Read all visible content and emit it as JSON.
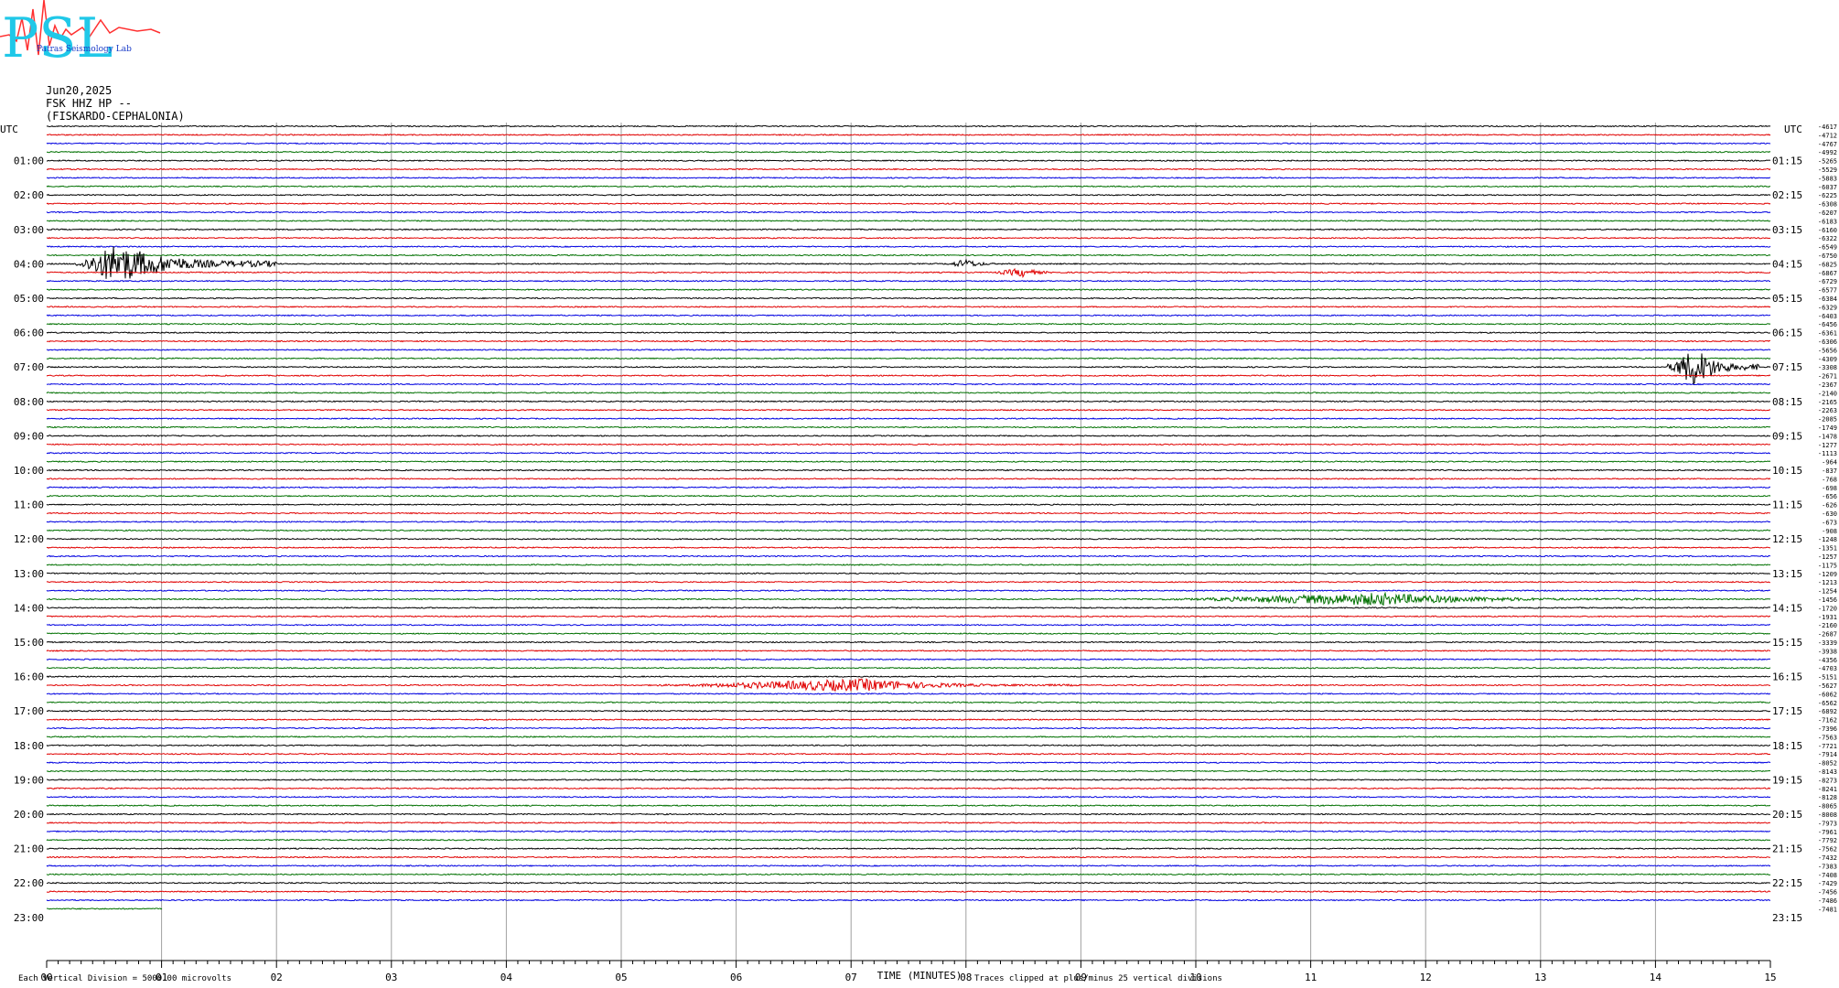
{
  "logo": {
    "letters": "PSL",
    "text": "Patras Seismology Lab"
  },
  "header": {
    "date": "Jun20,2025",
    "channel": "FSK HHZ HP --",
    "site": "(FISKARDO-CEPHALONIA)"
  },
  "chart_data": {
    "type": "line",
    "title": "",
    "xlabel": "TIME (MINUTES)",
    "x_ticks": [
      "00",
      "01",
      "02",
      "03",
      "04",
      "05",
      "06",
      "07",
      "08",
      "09",
      "10",
      "11",
      "12",
      "13",
      "14",
      "15"
    ],
    "x_range": [
      0,
      15
    ],
    "left_axis_label": "UTC",
    "right_axis_label": "UTC",
    "left_labels": [
      "01:00",
      "02:00",
      "03:00",
      "04:00",
      "05:00",
      "06:00",
      "07:00",
      "08:00",
      "09:00",
      "10:00",
      "11:00",
      "12:00",
      "13:00",
      "14:00",
      "15:00",
      "16:00",
      "17:00",
      "18:00",
      "19:00",
      "20:00",
      "21:00",
      "22:00",
      "23:00"
    ],
    "right_labels": [
      "01:15",
      "02:15",
      "03:15",
      "04:15",
      "05:15",
      "06:15",
      "07:15",
      "08:15",
      "09:15",
      "10:15",
      "11:15",
      "12:15",
      "13:15",
      "14:15",
      "15:15",
      "16:15",
      "17:15",
      "18:15",
      "19:15",
      "20:15",
      "21:15",
      "22:15",
      "23:15"
    ],
    "trace_colors": [
      "#000000",
      "#e00000",
      "#0000e0",
      "#007000"
    ],
    "offsets": [
      "-4617",
      "-4712",
      "-4767",
      "-4992",
      "-5265",
      "-5529",
      "-5883",
      "-6037",
      "-6225",
      "-6308",
      "-6207",
      "-6183",
      "-6160",
      "-6322",
      "-6549",
      "-6750",
      "-6825",
      "-6867",
      "-6729",
      "-6577",
      "-6384",
      "-6329",
      "-6403",
      "-6456",
      "-6361",
      "-6306",
      "-5656",
      "-4309",
      "-3308",
      "-2671",
      "-2367",
      "-2140",
      "-2165",
      "-2263",
      "-2085",
      "-1749",
      "-1478",
      "-1277",
      "-1113",
      "-964",
      "-837",
      "-768",
      "-698",
      "-656",
      "-626",
      "-630",
      "-673",
      "-908",
      "-1248",
      "-1351",
      "-1257",
      "-1175",
      "-1209",
      "-1213",
      "-1254",
      "-1456",
      "-1720",
      "-1931",
      "-2160",
      "-2687",
      "-3339",
      "-3938",
      "-4356",
      "-4703",
      "-5151",
      "-5627",
      "-6062",
      "-6562",
      "-6892",
      "-7162",
      "-7396",
      "-7563",
      "-7721",
      "-7914",
      "-8052",
      "-8143",
      "-8273",
      "-8241",
      "-8128",
      "-8065",
      "-8008",
      "-7973",
      "-7961",
      "-7792",
      "-7562",
      "-7432",
      "-7383",
      "-7408",
      "-7429",
      "-7456",
      "-7486",
      "-7481"
    ],
    "events": [
      {
        "row": 16,
        "start_min": 0.25,
        "end_min": 2.0,
        "peak_min": 0.6,
        "amp": "clipped",
        "color": "#000000"
      },
      {
        "row": 16,
        "start_min": 7.8,
        "end_min": 8.4,
        "peak_min": 8.0,
        "amp": "small",
        "color": "#000000"
      },
      {
        "row": 17,
        "start_min": 8.2,
        "end_min": 8.9,
        "peak_min": 8.5,
        "amp": "small",
        "color": "#e00000"
      },
      {
        "row": 28,
        "start_min": 14.1,
        "end_min": 14.9,
        "peak_min": 14.35,
        "amp": "large",
        "color": "#000000"
      },
      {
        "row": 55,
        "start_min": 9.7,
        "end_min": 14.2,
        "peak_min": 11.6,
        "amp": "medium",
        "color": "#007000"
      },
      {
        "row": 65,
        "start_min": 5.3,
        "end_min": 9.0,
        "peak_min": 7.1,
        "amp": "medium",
        "color": "#e00000"
      }
    ],
    "last_row_end_min": 1.0,
    "grid": "vertical minute lines"
  },
  "footer": {
    "left": "Each Vertical Division = 5000.00 microvolts",
    "middle": "Traces clipped at plus/minus 25 vertical divisions"
  }
}
